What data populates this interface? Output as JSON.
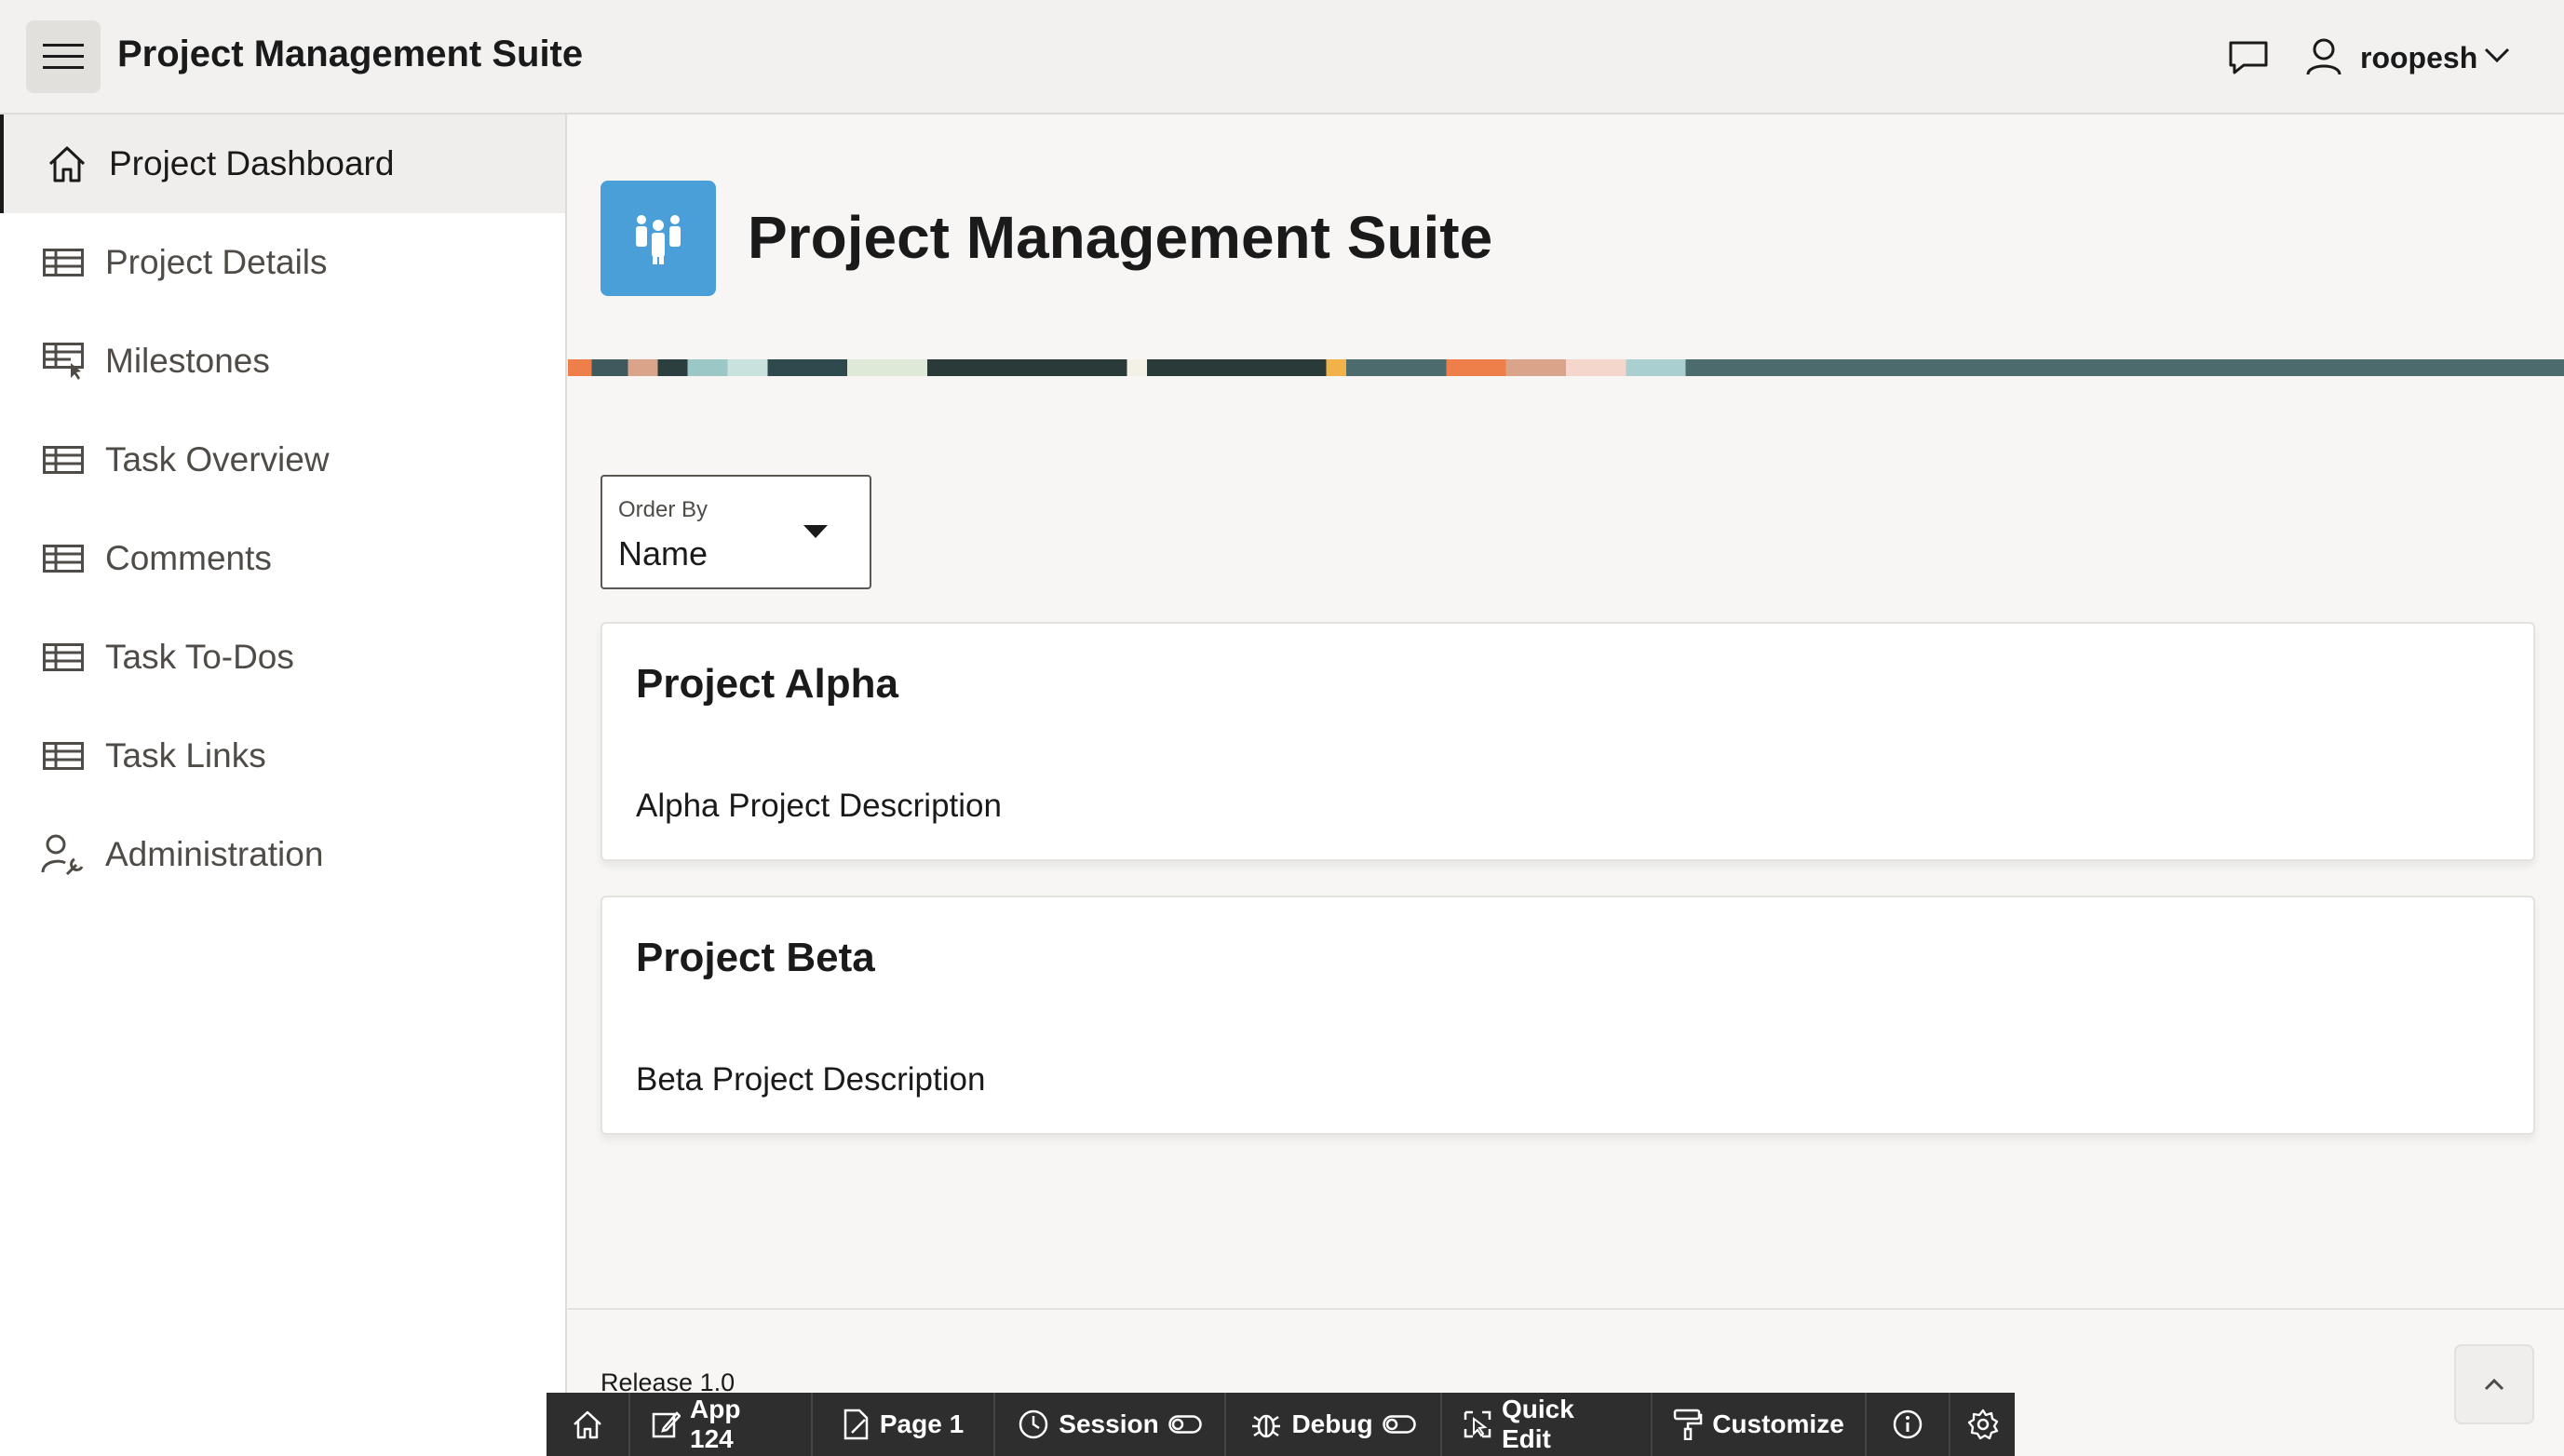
{
  "header": {
    "app_title": "Project Management Suite",
    "user_name": "roopesh"
  },
  "sidebar": {
    "items": [
      {
        "label": "Project Dashboard",
        "icon": "home-icon",
        "active": true
      },
      {
        "label": "Project Details",
        "icon": "table-icon"
      },
      {
        "label": "Milestones",
        "icon": "table-pointer-icon"
      },
      {
        "label": "Task Overview",
        "icon": "table-icon"
      },
      {
        "label": "Comments",
        "icon": "table-icon"
      },
      {
        "label": "Task To-Dos",
        "icon": "table-icon"
      },
      {
        "label": "Task Links",
        "icon": "table-icon"
      },
      {
        "label": "Administration",
        "icon": "user-wrench-icon"
      }
    ]
  },
  "main": {
    "page_title": "Project Management Suite",
    "order_by": {
      "label": "Order By",
      "value": "Name"
    },
    "cards": [
      {
        "title": "Project Alpha",
        "description": "Alpha Project Description"
      },
      {
        "title": "Project Beta",
        "description": "Beta Project Description"
      }
    ],
    "release": "Release 1.0"
  },
  "devbar": {
    "app": "App 124",
    "page": "Page 1",
    "session": "Session",
    "debug": "Debug",
    "quick_edit": "Quick Edit",
    "customize": "Customize"
  },
  "colors": {
    "accent": "#4a9fd9",
    "devbar": "#2e2e2e"
  }
}
